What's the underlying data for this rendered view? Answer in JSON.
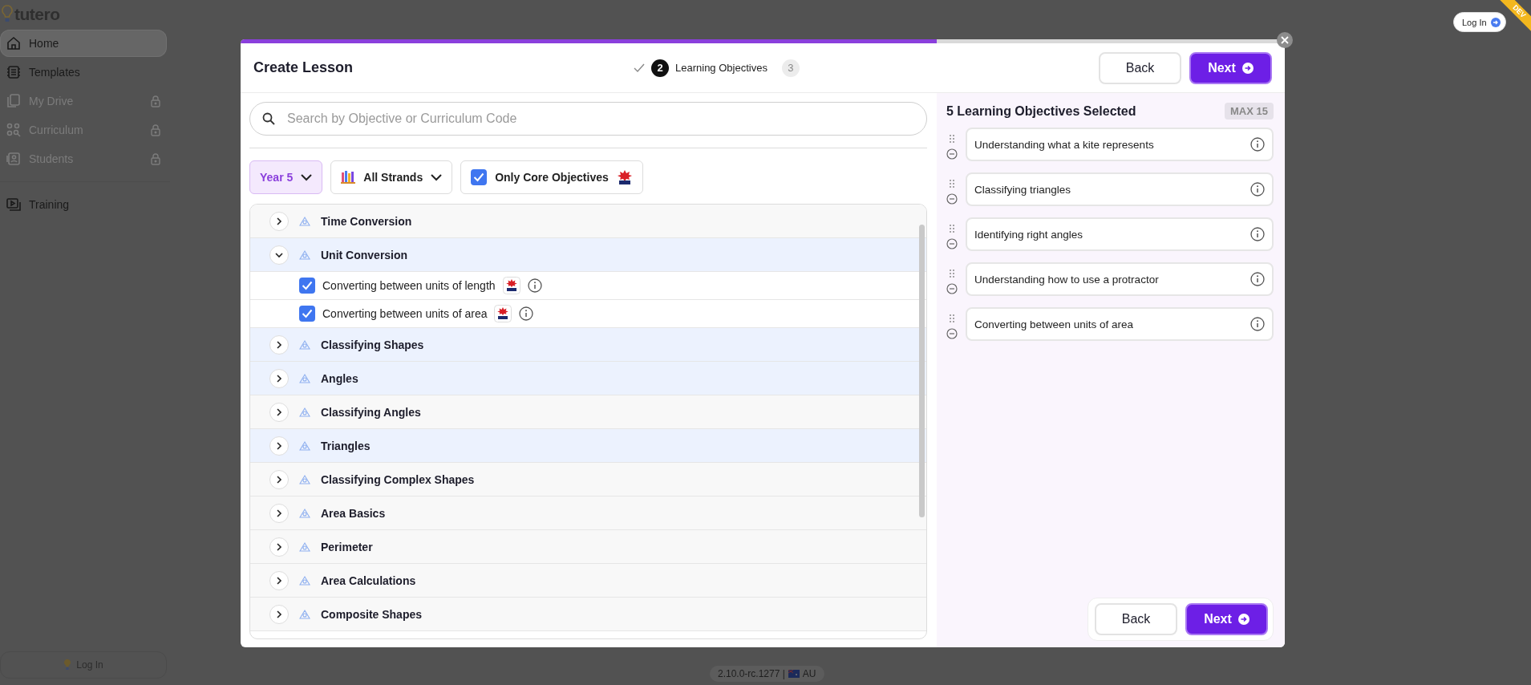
{
  "app": {
    "logo": "tutero"
  },
  "sidebar": {
    "items": [
      {
        "label": "Home",
        "selected": true,
        "locked": false
      },
      {
        "label": "Templates",
        "selected": false,
        "locked": false
      },
      {
        "label": "My Drive",
        "selected": false,
        "locked": true
      },
      {
        "label": "Curriculum",
        "selected": false,
        "locked": true
      },
      {
        "label": "Students",
        "selected": false,
        "locked": true
      },
      {
        "label": "Training",
        "selected": false,
        "locked": false
      }
    ],
    "login": "Log In"
  },
  "version": {
    "text": "2.10.0-rc.1277 |",
    "region": "AU"
  },
  "top_bar": {
    "login": "Log In",
    "ribbon": "DEV"
  },
  "dialog": {
    "progress": {
      "level": 0.667
    },
    "title": "Create Lesson",
    "steps": [
      {
        "completed": true
      },
      {
        "number": "2",
        "label": "Learning Objectives",
        "completed": false,
        "selected": true
      },
      {
        "number": "3",
        "completed": false,
        "selected": false
      }
    ],
    "buttons": {
      "back": "Back",
      "next": "Next"
    },
    "search": {
      "placeholder": "Search by Objective or Curriculum Code"
    },
    "filters": {
      "year": "Year 5",
      "strands": "All Strands",
      "core": {
        "label": "Only Core Objectives",
        "checked": true
      }
    },
    "topics": [
      {
        "label": "Time Conversion",
        "expanded": false,
        "highlighted": false
      },
      {
        "label": "Unit Conversion",
        "expanded": true,
        "highlighted": true,
        "children": [
          {
            "label": "Converting between units of length",
            "checked": true
          },
          {
            "label": "Converting between units of area",
            "checked": true
          }
        ]
      },
      {
        "label": "Classifying Shapes",
        "expanded": false,
        "highlighted": true
      },
      {
        "label": "Angles",
        "expanded": false,
        "highlighted": true
      },
      {
        "label": "Classifying Angles",
        "expanded": false,
        "highlighted": false
      },
      {
        "label": "Triangles",
        "expanded": false,
        "highlighted": true
      },
      {
        "label": "Classifying Complex Shapes",
        "expanded": false,
        "highlighted": false
      },
      {
        "label": "Area Basics",
        "expanded": false,
        "highlighted": false
      },
      {
        "label": "Perimeter",
        "expanded": false,
        "highlighted": false
      },
      {
        "label": "Area Calculations",
        "expanded": false,
        "highlighted": false
      },
      {
        "label": "Composite Shapes",
        "expanded": false,
        "highlighted": false
      }
    ],
    "selected_panel": {
      "heading": "5 Learning Objectives Selected",
      "max": "MAX 15",
      "objectives": [
        {
          "label": "Understanding what a kite represents"
        },
        {
          "label": "Classifying triangles"
        },
        {
          "label": "Identifying right angles"
        },
        {
          "label": "Understanding how to use a protractor"
        },
        {
          "label": "Converting between units of area"
        }
      ]
    },
    "footer_buttons": {
      "back": "Back",
      "next": "Next"
    }
  }
}
